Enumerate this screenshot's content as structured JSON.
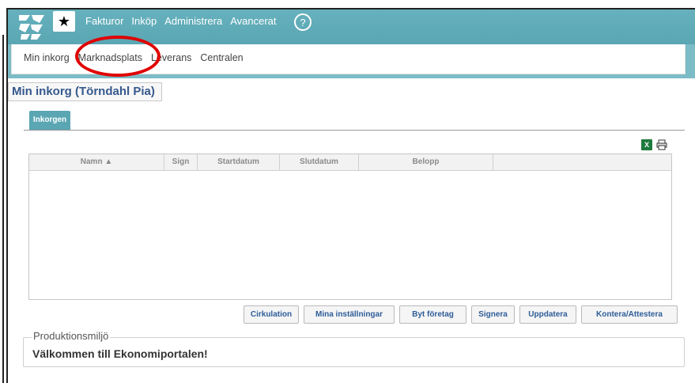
{
  "topbar": {
    "menu": [
      "Fakturor",
      "Inköp",
      "Administrera",
      "Avancerat"
    ],
    "help_label": "?",
    "star_label": "★"
  },
  "subnav": {
    "items": [
      "Min inkorg",
      "Marknadsplats",
      "Leverans",
      "Centralen"
    ]
  },
  "page": {
    "title": "Min inkorg (Törndahl Pia)",
    "tab_label": "Inkorgen"
  },
  "table": {
    "columns": [
      "Namn ▲",
      "Sign",
      "Startdatum",
      "Slutdatum",
      "Belopp",
      ""
    ],
    "rows": []
  },
  "toolbar": {
    "buttons": [
      "Cirkulation",
      "Mina inställningar",
      "Byt företag",
      "Signera",
      "Uppdatera",
      "Kontera/Attestera"
    ]
  },
  "footer": {
    "legend": "Produktionsmiljö",
    "welcome": "Välkommen till Ekonomiportalen!"
  },
  "colors": {
    "teal": "#5aa6b3",
    "title_blue": "#35588d",
    "button_text": "#2e5d98",
    "annotation_red": "#e00000"
  },
  "icons": [
    "logo-icon",
    "star-icon",
    "help-icon",
    "excel-icon",
    "print-icon"
  ]
}
